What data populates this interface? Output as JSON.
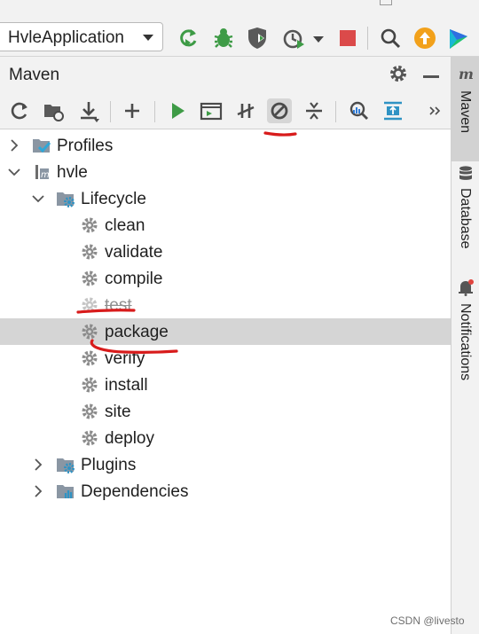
{
  "window_toolbar": {
    "run_configuration": "HvleApplication",
    "icons": [
      "rebuild-icon",
      "debug-icon",
      "coverage-icon",
      "profiler-icon",
      "stop-icon",
      "search-icon",
      "update-icon",
      "toolbox-icon"
    ],
    "colors": {
      "run_green": "#3e9b46",
      "stop_red": "#db4a4a",
      "update_orange": "#f2a11b"
    }
  },
  "maven_panel": {
    "title": "Maven",
    "toolbar_icons": [
      "reload-icon",
      "generate-sources-icon",
      "download-icon",
      "add-icon",
      "run-icon",
      "execute-goal-icon",
      "toggle-offline-icon",
      "skip-tests-icon",
      "collapse-all-icon",
      "analyze-dependencies-icon",
      "show-diagram-icon",
      "more-icon"
    ],
    "active_toolbar_button": "skip-tests-icon"
  },
  "tree": {
    "profiles": "Profiles",
    "project": "hvle",
    "lifecycle": "Lifecycle",
    "phases": [
      "clean",
      "validate",
      "compile",
      "test",
      "package",
      "verify",
      "install",
      "site",
      "deploy"
    ],
    "skipped_phase": "test",
    "selected_phase": "package",
    "plugins": "Plugins",
    "dependencies": "Dependencies"
  },
  "right_stripe": {
    "maven": "Maven",
    "database": "Database",
    "notifications": "Notifications"
  },
  "annotation_color": "#d81b1b",
  "watermark": "CSDN @livesto"
}
